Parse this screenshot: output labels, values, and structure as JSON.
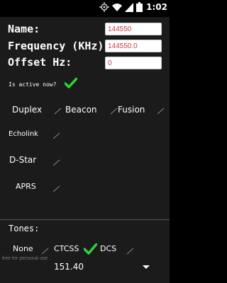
{
  "status_bar": {
    "time": "1:02",
    "icons": [
      "sync-icon",
      "wifi-icon",
      "signal-icon",
      "battery-icon"
    ]
  },
  "form": {
    "name_label": "Name:",
    "name_value": "144550",
    "frequency_label": "Frequency (KHz)",
    "frequency_value": "144550.0",
    "offset_label": "Offset Hz:",
    "offset_value": "0",
    "active_label": "Is active now?",
    "active_checked": true
  },
  "modes": {
    "duplex": "Duplex",
    "beacon": "Beacon",
    "fusion": "Fusion",
    "echolink": "Echolink",
    "dstar": "D-Star",
    "aprs": "APRS"
  },
  "tones": {
    "label": "Tones:",
    "none": "None",
    "ctcss": "CTCSS",
    "ctcss_checked": true,
    "dcs": "DCS",
    "selected_value": "151.40"
  },
  "footer": {
    "watermark": "free for personal use"
  },
  "colors": {
    "accent_check": "#2fd13a",
    "input_text": "#c04040",
    "background": "#1b1b1b"
  }
}
